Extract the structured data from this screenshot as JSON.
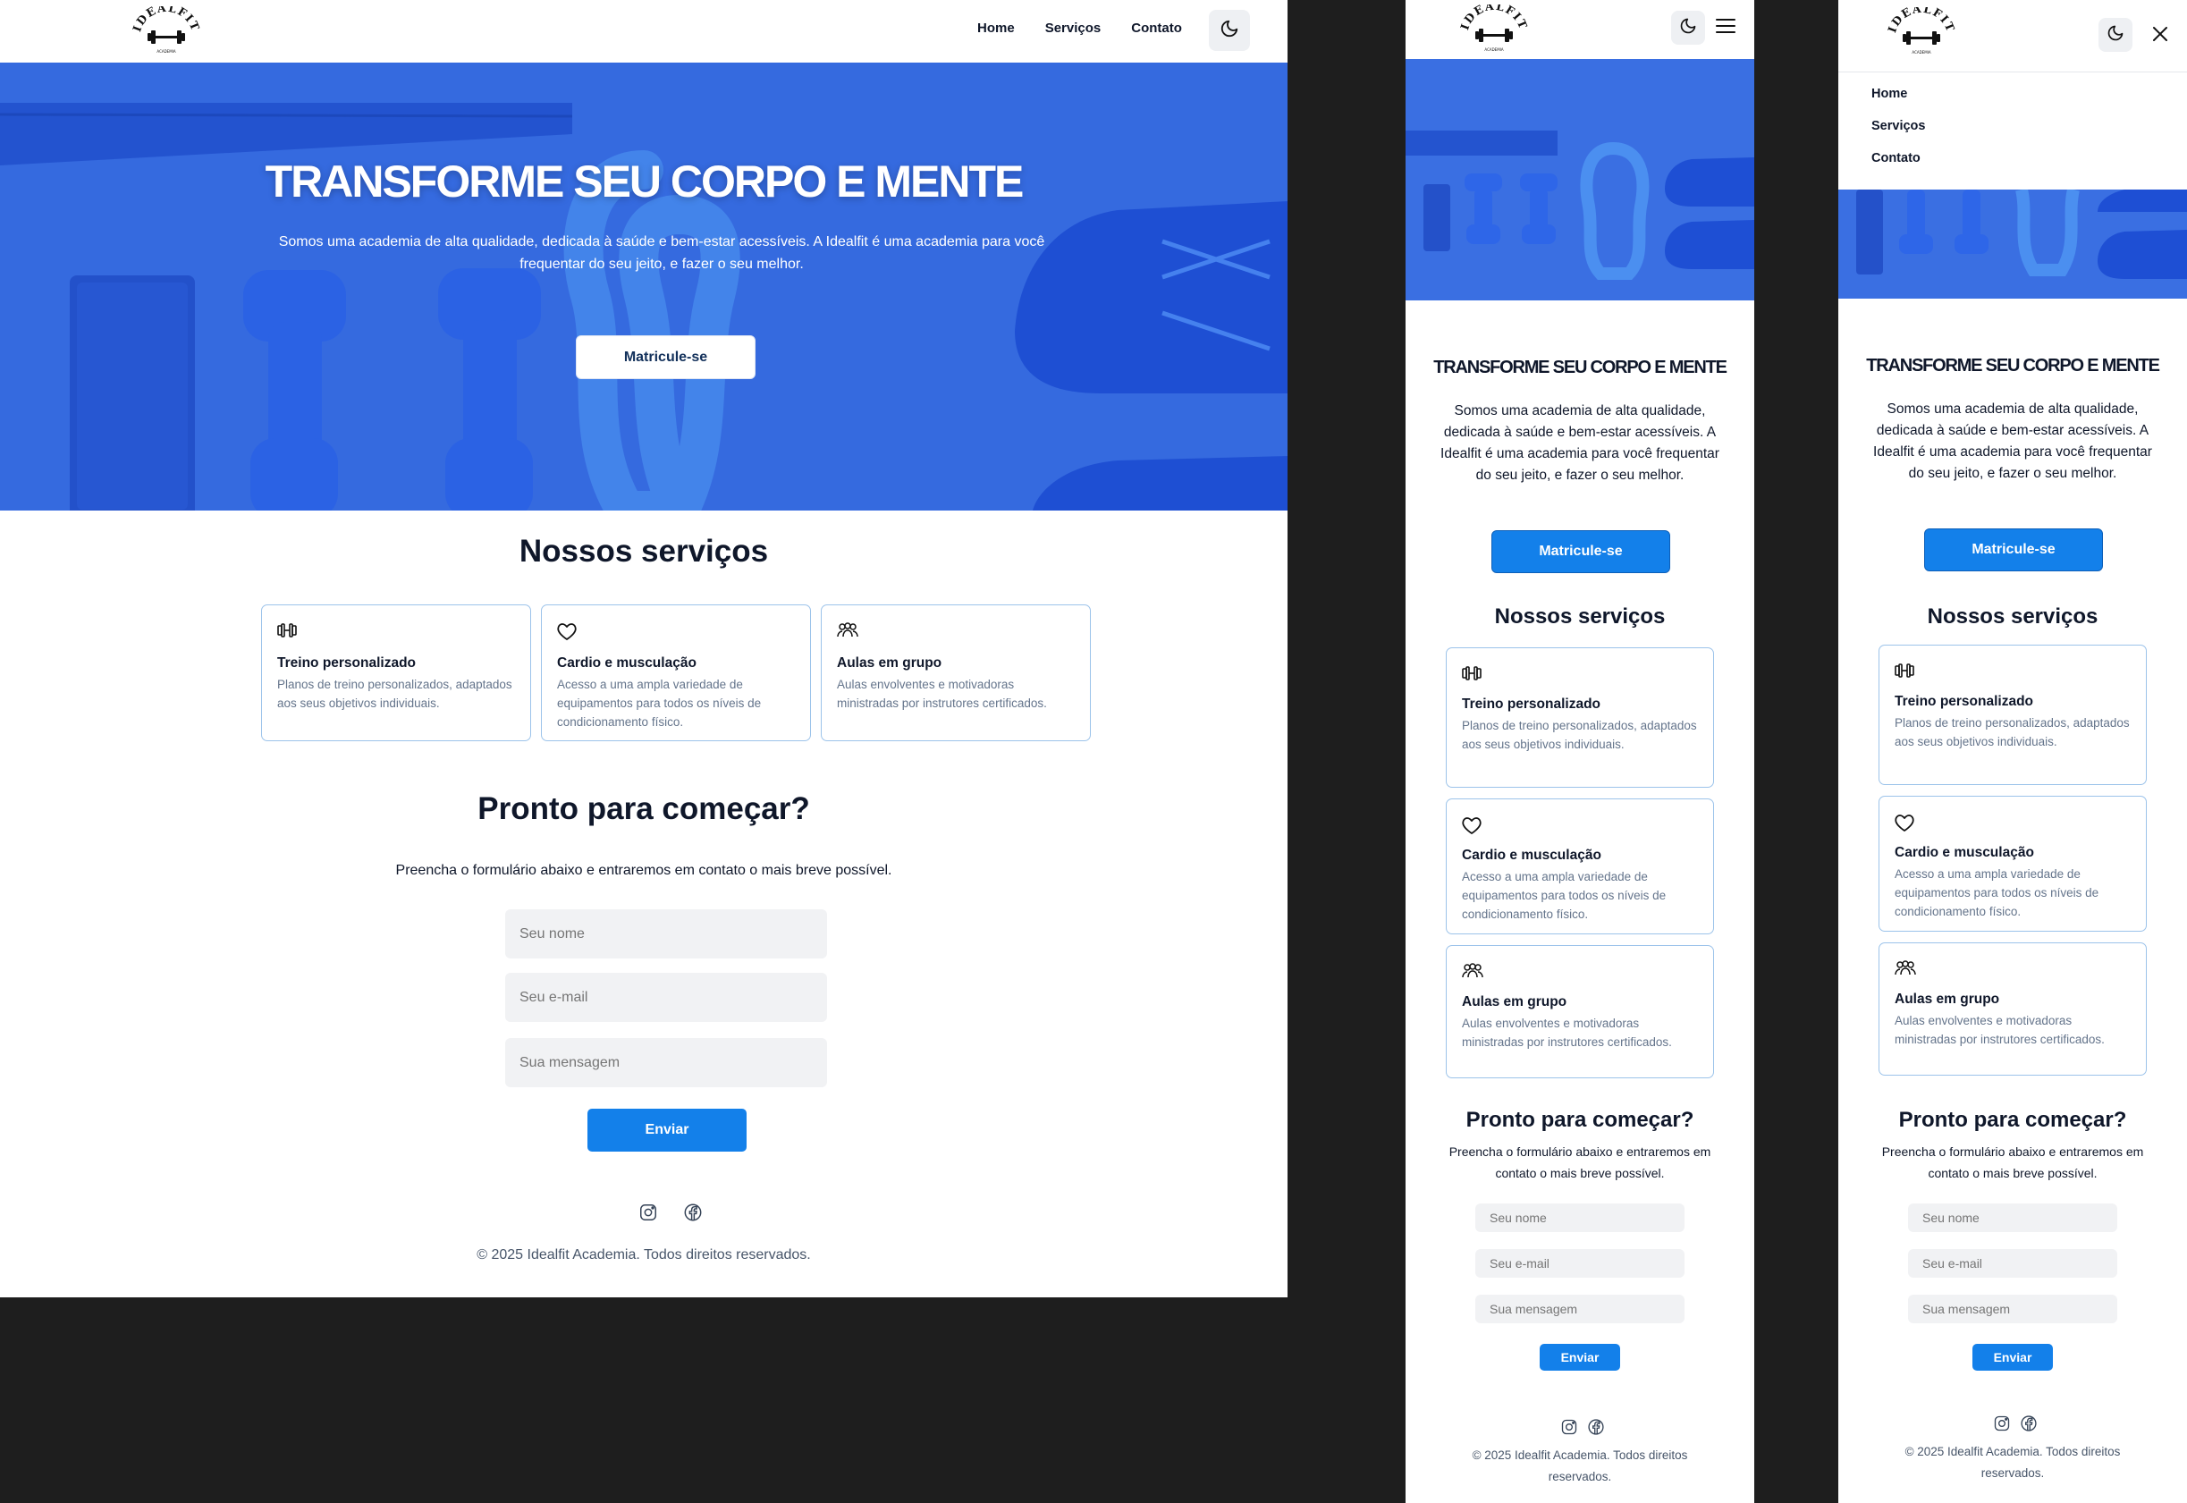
{
  "brand": {
    "logo_text": "IDEALFIT",
    "logo_subtext": "ACADEMIA"
  },
  "nav": {
    "items": [
      "Home",
      "Serviços",
      "Contato"
    ]
  },
  "icons": {
    "theme": "moon-icon",
    "menu": "hamburger-menu-icon",
    "close": "close-icon",
    "social": [
      "instagram-icon",
      "facebook-icon"
    ]
  },
  "hero": {
    "title": "TRANSFORME SEU CORPO E MENTE",
    "text": "Somos uma academia de alta qualidade, dedicada à saúde e bem-estar acessíveis. A Idealfit é uma academia para você frequentar do seu jeito, e fazer o seu melhor.",
    "cta_label": "Matricule-se"
  },
  "services": {
    "title": "Nossos serviços",
    "items": [
      {
        "icon": "dumbbell-icon",
        "title": "Treino personalizado",
        "description": "Planos de treino personalizados, adaptados aos seus objetivos individuais."
      },
      {
        "icon": "heart-icon",
        "title": "Cardio e musculação",
        "description": "Acesso a uma ampla variedade de equipamentos para todos os níveis de condicionamento físico."
      },
      {
        "icon": "group-icon",
        "title": "Aulas em grupo",
        "description": "Aulas envolventes e motivadoras ministradas por instrutores certificados."
      }
    ]
  },
  "contact": {
    "title": "Pronto para começar?",
    "subtitle": "Preencha o formulário abaixo e entraremos em contato o mais breve possível.",
    "name_placeholder": "Seu nome",
    "email_placeholder": "Seu e-mail",
    "message_placeholder": "Sua mensagem",
    "submit_label": "Enviar"
  },
  "footer": {
    "copyright": "© 2025 Idealfit Academia. Todos direitos reservados."
  },
  "colors": {
    "primary": "#1380ea",
    "hero_blue": "#2f63db",
    "card_border": "#9cc3ea",
    "input_bg": "#f1f2f4",
    "gutter": "#1e1e1e"
  }
}
